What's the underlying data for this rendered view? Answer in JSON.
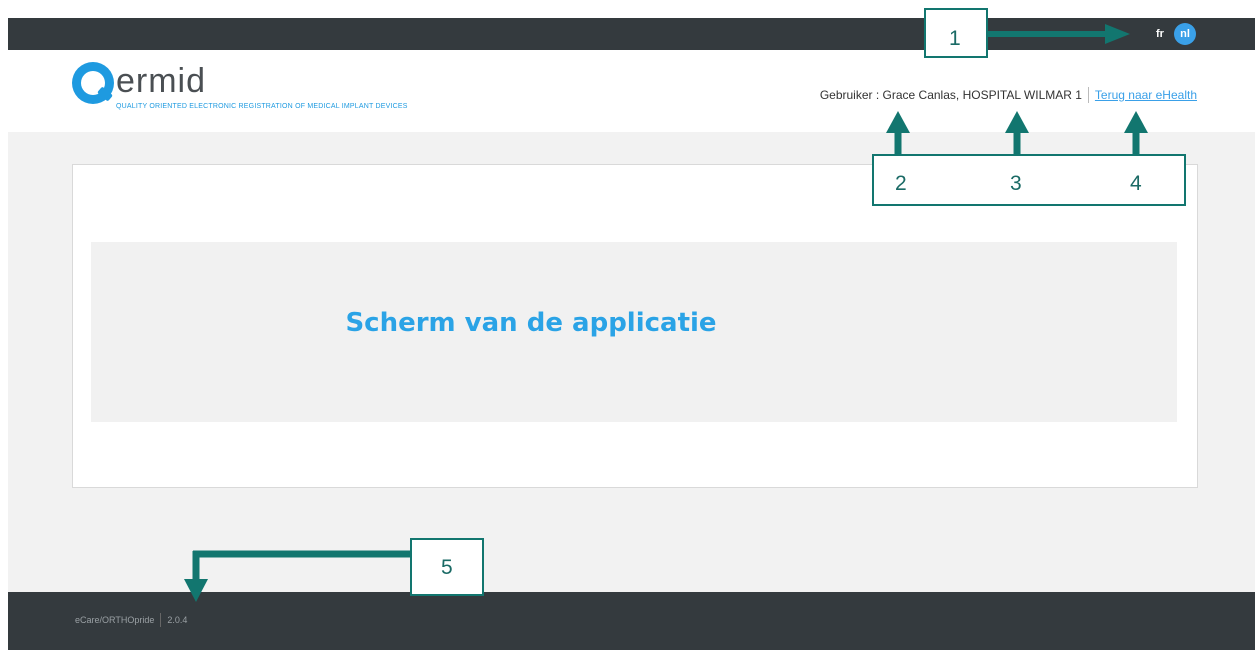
{
  "topbar": {
    "languages": [
      "fr",
      "nl"
    ],
    "active_language": "nl"
  },
  "logo": {
    "word": "ermid",
    "tagline": "QUALITY ORIENTED ELECTRONIC REGISTRATION OF MEDICAL IMPLANT DEVICES"
  },
  "header": {
    "user_label": "Gebruiker :",
    "user_name": "Grace Canlas,",
    "organization": "HOSPITAL WILMAR 1",
    "ehealth_link": "Terug naar eHealth"
  },
  "main": {
    "screen_title": "Scherm van de applicatie"
  },
  "footer": {
    "app_name": "eCare/ORTHOpride",
    "version": "2.0.4"
  },
  "callouts": {
    "c1": "1",
    "c2": "2",
    "c3": "3",
    "c4": "4",
    "c5": "5"
  },
  "colors": {
    "accent": "#1e9ae0",
    "callout": "#12766f",
    "bar": "#343a3e"
  }
}
